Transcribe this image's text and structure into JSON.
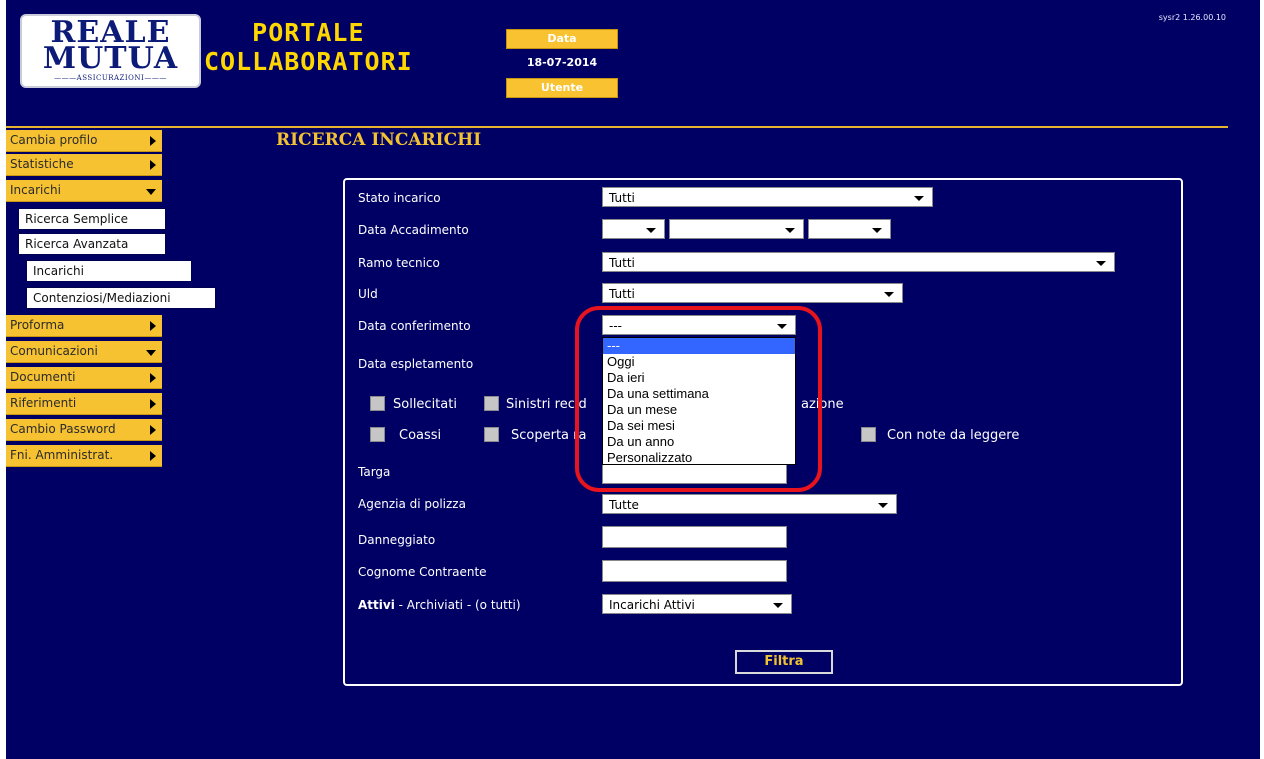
{
  "header": {
    "logo": {
      "line1": "REALE",
      "line2": "MUTUA",
      "line3": "ASSICURAZIONI"
    },
    "portal_title_line1": "PORTALE",
    "portal_title_line2": "COLLABORATORI",
    "data_label": "Data",
    "date_value": "18-07-2014",
    "user_label": "Utente",
    "version": "sysr2 1.26.00.10"
  },
  "colors": {
    "background": "#000064",
    "accent": "#f7c232",
    "highlight": "#e8141d"
  },
  "sidebar": {
    "items": [
      {
        "label": "Cambia profilo",
        "arrow": "right"
      },
      {
        "label": "Statistiche",
        "arrow": "right"
      },
      {
        "label": "Incarichi",
        "arrow": "down"
      },
      {
        "label": "Proforma",
        "arrow": "right"
      },
      {
        "label": "Comunicazioni",
        "arrow": "down"
      },
      {
        "label": "Documenti",
        "arrow": "right"
      },
      {
        "label": "Riferimenti",
        "arrow": "right"
      },
      {
        "label": "Cambio Password",
        "arrow": "right"
      },
      {
        "label": "Fni. Amministrat.",
        "arrow": "right"
      }
    ],
    "subitems": {
      "ricerca_semplice": "Ricerca Semplice",
      "ricerca_avanzata": "Ricerca Avanzata",
      "incarichi": "Incarichi",
      "contenziosi": "Contenziosi/Mediazioni"
    }
  },
  "page_title": "RICERCA INCARICHI",
  "form": {
    "stato_incarico": {
      "label": "Stato incarico",
      "value": "Tutti"
    },
    "data_accadimento": {
      "label": "Data Accadimento"
    },
    "ramo_tecnico": {
      "label": "Ramo tecnico",
      "value": "Tutti"
    },
    "uld": {
      "label": "Uld",
      "value": "Tutti"
    },
    "data_conferimento": {
      "label": "Data conferimento",
      "value": "---"
    },
    "data_espletamento": {
      "label": "Data espletamento"
    },
    "checkboxes": {
      "sollecitati": "Sollecitati",
      "sinistri_partial": "Sinistri recid",
      "zione_partial": "azione",
      "coassi": "Coassi",
      "scopertura_partial": "Scoperta ra",
      "con_note": "Con note da leggere"
    },
    "targa": {
      "label": "Targa"
    },
    "agenzia_polizza": {
      "label": "Agenzia di polizza",
      "value": "Tutte"
    },
    "danneggiato": {
      "label": "Danneggiato"
    },
    "cognome_contraente": {
      "label": "Cognome Contraente"
    },
    "attivi": {
      "label_bold": "Attivi",
      "label_rest": " - Archiviati - (o tutti)",
      "value": "Incarichi Attivi"
    },
    "filter_button": "Filtra"
  },
  "dropdown": {
    "options": [
      "---",
      "Oggi",
      "Da ieri",
      "Da una settimana",
      "Da un mese",
      "Da sei mesi",
      "Da un anno",
      "Personalizzato"
    ],
    "selected_index": 0
  }
}
